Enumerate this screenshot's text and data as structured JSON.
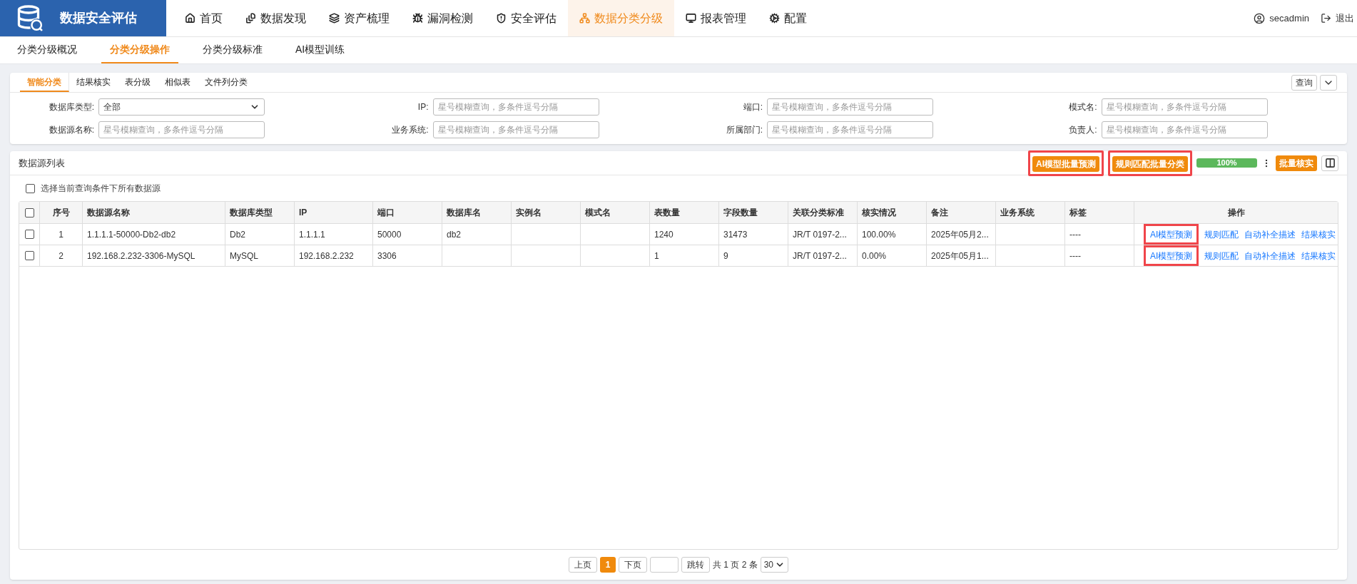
{
  "app": {
    "title": "数据安全评估"
  },
  "nav": [
    {
      "label": "首页",
      "selected": false
    },
    {
      "label": "数据发现",
      "selected": false
    },
    {
      "label": "资产梳理",
      "selected": false
    },
    {
      "label": "漏洞检测",
      "selected": false
    },
    {
      "label": "安全评估",
      "selected": false
    },
    {
      "label": "数据分类分级",
      "selected": true
    },
    {
      "label": "报表管理",
      "selected": false
    },
    {
      "label": "配置",
      "selected": false
    }
  ],
  "user": {
    "name": "secadmin"
  },
  "logout": {
    "label": "退出"
  },
  "subnav": [
    {
      "label": "分类分级概况",
      "selected": false
    },
    {
      "label": "分类分级操作",
      "selected": true
    },
    {
      "label": "分类分级标准",
      "selected": false
    },
    {
      "label": "AI模型训练",
      "selected": false
    }
  ],
  "filter_tabs": [
    {
      "label": "智能分类",
      "selected": true
    },
    {
      "label": "结果核实",
      "selected": false
    },
    {
      "label": "表分级",
      "selected": false
    },
    {
      "label": "相似表",
      "selected": false
    },
    {
      "label": "文件列分类",
      "selected": false
    }
  ],
  "query_button": "查询",
  "filters": [
    {
      "label": "数据库类型:",
      "kind": "select",
      "value": "全部"
    },
    {
      "label": "IP:",
      "kind": "input",
      "placeholder": "星号模糊查询，多条件逗号分隔"
    },
    {
      "label": "端口:",
      "kind": "input",
      "placeholder": "星号模糊查询，多条件逗号分隔"
    },
    {
      "label": "模式名:",
      "kind": "input",
      "placeholder": "星号模糊查询，多条件逗号分隔"
    },
    {
      "label": "数据源名称:",
      "kind": "input",
      "placeholder": "星号模糊查询，多条件逗号分隔"
    },
    {
      "label": "业务系统:",
      "kind": "input",
      "placeholder": "星号模糊查询，多条件逗号分隔"
    },
    {
      "label": "所属部门:",
      "kind": "input",
      "placeholder": "星号模糊查询，多条件逗号分隔"
    },
    {
      "label": "负责人:",
      "kind": "input",
      "placeholder": "星号模糊查询，多条件逗号分隔"
    }
  ],
  "list": {
    "title": "数据源列表",
    "toolbar": [
      {
        "label": "AI模型批量预测",
        "highlighted": true
      },
      {
        "label": "规则匹配批量分类",
        "highlighted": true
      }
    ],
    "progress": {
      "level": 1,
      "reading": "100%"
    },
    "verify_button": "批量核实",
    "select_all": {
      "label": "选择当前查询条件下所有数据源",
      "checked": false
    }
  },
  "table": {
    "header_checked": false,
    "columns": [
      "序号",
      "数据源名称",
      "数据库类型",
      "IP",
      "端口",
      "数据库名",
      "实例名",
      "模式名",
      "表数量",
      "字段数量",
      "关联分类标准",
      "核实情况",
      "备注",
      "业务系统",
      "标签",
      "操作"
    ],
    "rows": [
      {
        "checked": false,
        "cells": [
          "1",
          "1.1.1.1-50000-Db2-db2",
          "Db2",
          "1.1.1.1",
          "50000",
          "db2",
          "",
          "",
          "1240",
          "31473",
          "JR/T 0197-2...",
          "100.00%",
          "2025年05月2...",
          "",
          "----"
        ],
        "actions": [
          {
            "label": "AI模型预测",
            "highlighted": true
          },
          {
            "label": "规则匹配",
            "highlighted": false
          },
          {
            "label": "自动补全描述",
            "highlighted": false
          },
          {
            "label": "结果核实",
            "highlighted": false
          }
        ]
      },
      {
        "checked": false,
        "cells": [
          "2",
          "192.168.2.232-3306-MySQL",
          "MySQL",
          "192.168.2.232",
          "3306",
          "",
          "",
          "",
          "1",
          "9",
          "JR/T 0197-2...",
          "0.00%",
          "2025年05月1...",
          "",
          "----"
        ],
        "actions": [
          {
            "label": "AI模型预测",
            "highlighted": true
          },
          {
            "label": "规则匹配",
            "highlighted": false
          },
          {
            "label": "自动补全描述",
            "highlighted": false
          },
          {
            "label": "结果核实",
            "highlighted": false
          }
        ]
      }
    ]
  },
  "pagination": {
    "prev": "上页",
    "pages": [
      {
        "label": "1",
        "selected": true
      }
    ],
    "next": "下页",
    "jump": "跳转",
    "summary": "共 1 页 2 条",
    "page_size": "30"
  }
}
